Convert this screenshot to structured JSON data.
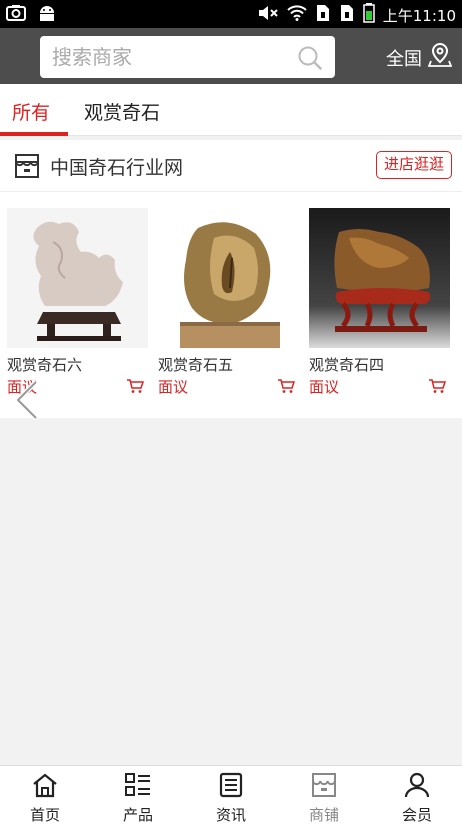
{
  "status_bar": {
    "time": "上午11:10",
    "icons": [
      "camera-icon",
      "android-icon",
      "mute-icon",
      "wifi-icon",
      "sim1-icon",
      "sim2-icon",
      "battery-icon"
    ]
  },
  "header": {
    "search_placeholder": "搜索商家",
    "region_label": "全国",
    "background": "#4d4d4d"
  },
  "tabs": [
    {
      "label": "所有",
      "active": true
    },
    {
      "label": "观赏奇石",
      "active": false
    }
  ],
  "shop": {
    "name": "中国奇石行业网",
    "visit_label": "进店逛逛"
  },
  "products": [
    {
      "name": "观赏奇石六",
      "price": "面议"
    },
    {
      "name": "观赏奇石五",
      "price": "面议"
    },
    {
      "name": "观赏奇石四",
      "price": "面议"
    }
  ],
  "bottom_nav": [
    {
      "label": "首页",
      "icon": "home-icon"
    },
    {
      "label": "产品",
      "icon": "list-icon"
    },
    {
      "label": "资讯",
      "icon": "news-icon"
    },
    {
      "label": "商铺",
      "icon": "shop-icon"
    },
    {
      "label": "会员",
      "icon": "user-icon"
    }
  ],
  "colors": {
    "accent": "#dd2222",
    "header": "#4d4d4d",
    "page_bg": "#f2f2f2"
  }
}
